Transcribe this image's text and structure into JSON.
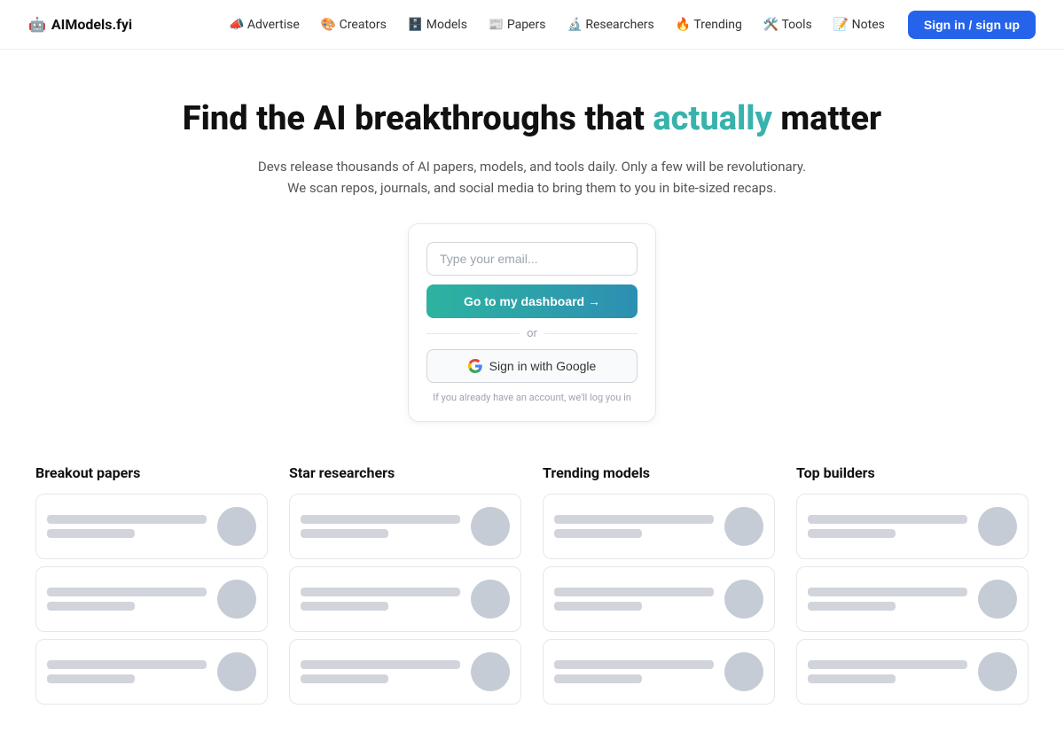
{
  "logo": {
    "emoji": "🤖",
    "name": "AIModels.fyi"
  },
  "nav": {
    "links": [
      {
        "emoji": "📣",
        "label": "Advertise"
      },
      {
        "emoji": "🎨",
        "label": "Creators"
      },
      {
        "emoji": "🗄️",
        "label": "Models"
      },
      {
        "emoji": "📰",
        "label": "Papers"
      },
      {
        "emoji": "🔬",
        "label": "Researchers"
      },
      {
        "emoji": "🔥",
        "label": "Trending"
      },
      {
        "emoji": "🛠️",
        "label": "Tools"
      },
      {
        "emoji": "📝",
        "label": "Notes"
      }
    ],
    "signin_label": "Sign in / sign up"
  },
  "hero": {
    "title_start": "Find the AI breakthroughs that ",
    "title_accent": "actually",
    "title_end": " matter",
    "subtitle": "Devs release thousands of AI papers, models, and tools daily. Only a few will be revolutionary. We scan repos, journals, and social media to bring them to you in bite-sized recaps.",
    "email_placeholder": "Type your email...",
    "dashboard_btn": "Go to my dashboard →",
    "or_label": "or",
    "google_btn": "Sign in with Google",
    "signin_note": "If you already have an account, we'll log you in"
  },
  "sections": [
    {
      "title": "Breakout papers"
    },
    {
      "title": "Star researchers"
    },
    {
      "title": "Trending models"
    },
    {
      "title": "Top builders"
    }
  ]
}
